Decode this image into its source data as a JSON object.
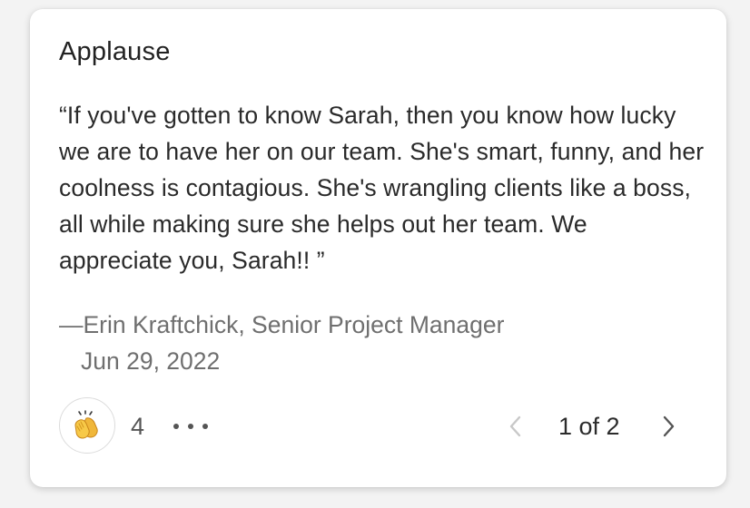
{
  "card": {
    "title": "Applause",
    "quote": "“If you've gotten to know Sarah, then you know how lucky we are to have her on our team. She's smart, funny, and her coolness is contagious. She's wrangling clients like a boss, all while making sure she helps out her team. We appreciate you, Sarah!! ”",
    "attribution": "—Erin Kraftchick, Senior Project Manager",
    "date": "Jun 29, 2022"
  },
  "reactions": {
    "icon": "clapping-hands-icon",
    "count": "4",
    "more_icon": "more-horizontal-icon"
  },
  "pager": {
    "prev_icon": "chevron-left-icon",
    "text": "1 of 2",
    "next_icon": "chevron-right-icon"
  },
  "colors": {
    "card_background": "#ffffff",
    "page_background": "#f3f3f3",
    "text_primary": "#2a2a2a",
    "text_secondary": "#6f6f6f",
    "disabled_chevron": "#c8c8c8"
  }
}
